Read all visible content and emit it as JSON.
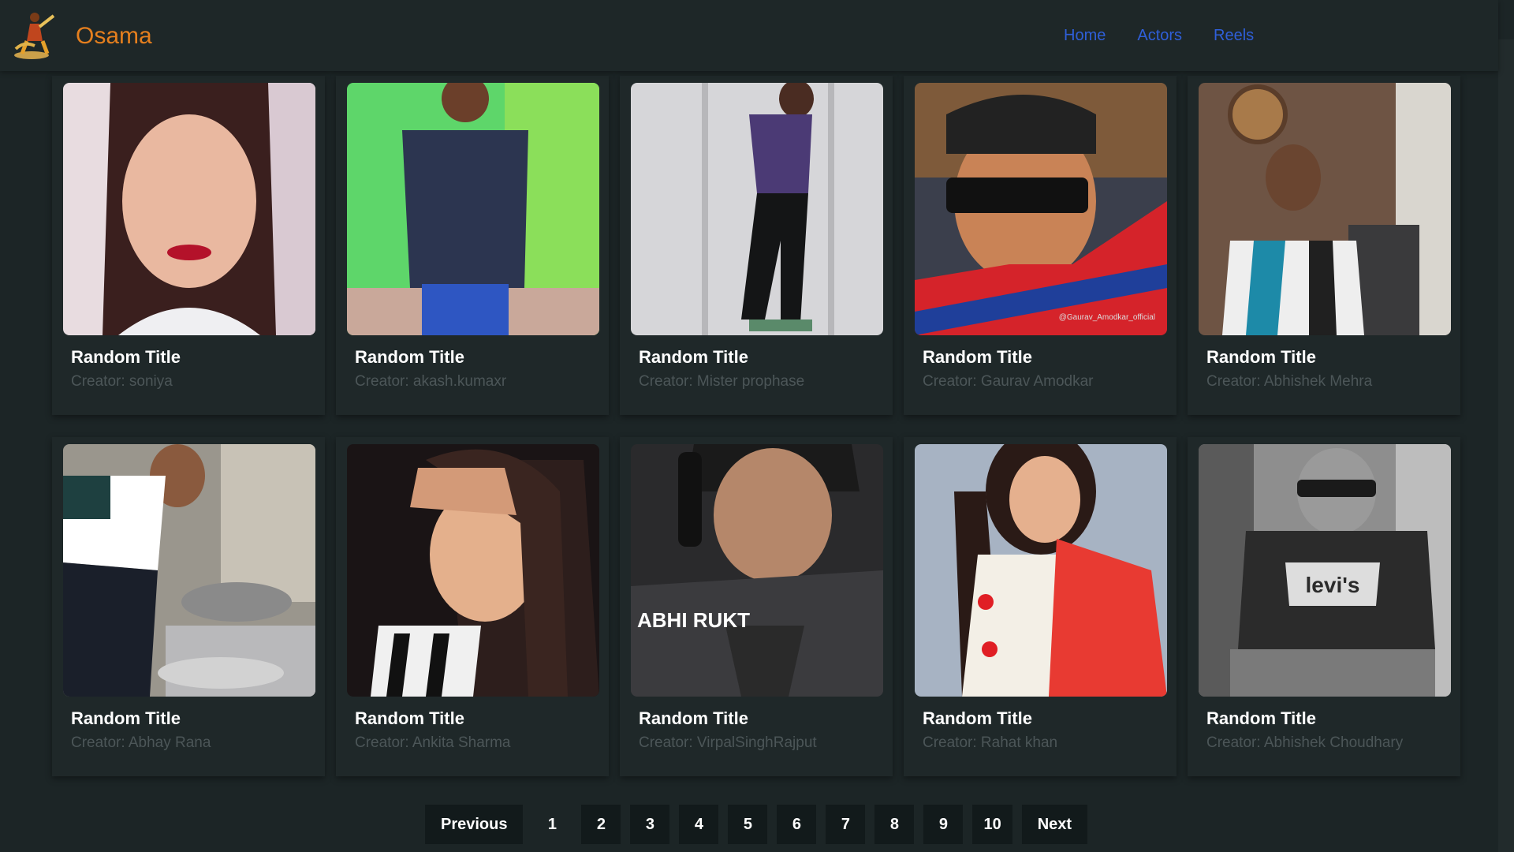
{
  "header": {
    "brand": "Osama",
    "nav": [
      {
        "label": "Home"
      },
      {
        "label": "Actors"
      },
      {
        "label": "Reels"
      }
    ]
  },
  "cards": [
    {
      "title": "Random Title",
      "creator": "Creator: soniya"
    },
    {
      "title": "Random Title",
      "creator": "Creator: akash.kumaxr"
    },
    {
      "title": "Random Title",
      "creator": "Creator: Mister prophase"
    },
    {
      "title": "Random Title",
      "creator": "Creator: Gaurav Amodkar",
      "watermark": "@Gaurav_Amodkar_official"
    },
    {
      "title": "Random Title",
      "creator": "Creator: Abhishek Mehra"
    },
    {
      "title": "Random Title",
      "creator": "Creator: Abhay Rana"
    },
    {
      "title": "Random Title",
      "creator": "Creator: Ankita Sharma"
    },
    {
      "title": "Random Title",
      "creator": "Creator: VirpalSinghRajput",
      "overlay_text": "ABHI RUKT"
    },
    {
      "title": "Random Title",
      "creator": "Creator: Rahat khan"
    },
    {
      "title": "Random Title",
      "creator": "Creator: Abhishek Choudhary",
      "shirt_text": "levi's"
    }
  ],
  "pagination": {
    "previous": "Previous",
    "next": "Next",
    "pages": [
      "1",
      "2",
      "3",
      "4",
      "5",
      "6",
      "7",
      "8",
      "9",
      "10"
    ],
    "current": "1"
  }
}
